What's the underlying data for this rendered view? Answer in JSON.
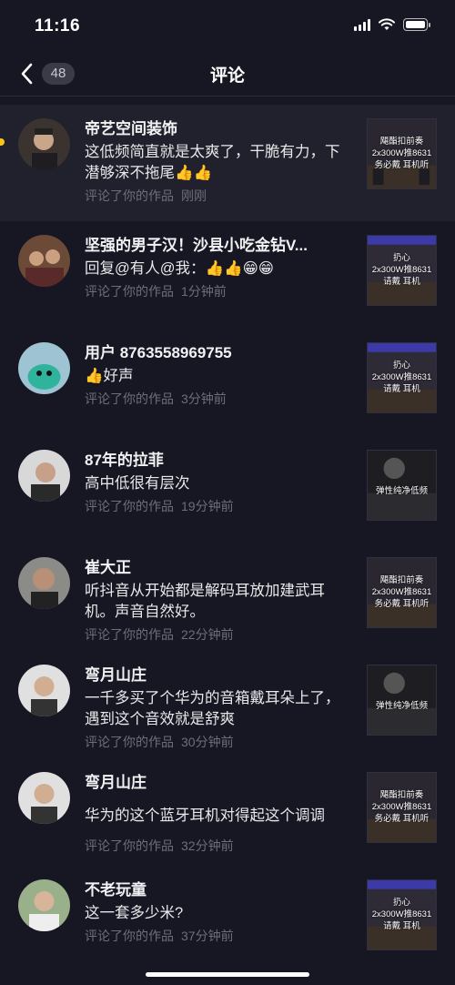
{
  "status_bar": {
    "time": "11:16"
  },
  "nav": {
    "back_count": "48",
    "title": "评论"
  },
  "comments": [
    {
      "name": "帝艺空间装饰",
      "text": "这低频简直就是太爽了，干脆有力，下潜够深不拖尾",
      "emoji": "👍👍",
      "action": "评论了你的作品",
      "time": "刚刚",
      "thumb_text": [
        "飓酯扣前奏",
        "2x300W推8631",
        "务必戴  耳机听"
      ]
    },
    {
      "name": "坚强的男子汉！沙县小吃金钻V...",
      "text": "回复@有人@我：",
      "emoji": "👍👍😁😁",
      "action": "评论了你的作品",
      "time": "1分钟前",
      "thumb_text": [
        "扔心",
        "2x300W推8631",
        "请戴  耳机"
      ]
    },
    {
      "name": "用户 8763558969755",
      "text": "好声",
      "emoji": "👍",
      "action": "评论了你的作品",
      "time": "3分钟前",
      "thumb_text": [
        "扔心",
        "2x300W推8631",
        "请戴  耳机"
      ]
    },
    {
      "name": "87年的拉菲",
      "text": "高中低很有层次",
      "emoji": "",
      "action": "评论了你的作品",
      "time": "19分钟前",
      "thumb_text": [
        "弹性纯净低频"
      ]
    },
    {
      "name": "崔大正",
      "text": "听抖音从开始都是解码耳放加建武耳机。声音自然好。",
      "emoji": "",
      "action": "评论了你的作品",
      "time": "22分钟前",
      "thumb_text": [
        "飓酯扣前奏",
        "2x300W推8631",
        "务必戴  耳机听"
      ]
    },
    {
      "name": "弯月山庄",
      "text": "一千多买了个华为的音箱戴耳朵上了，遇到这个音效就是舒爽",
      "emoji": "",
      "action": "评论了你的作品",
      "time": "30分钟前",
      "thumb_text": [
        "弹性纯净低频"
      ]
    },
    {
      "name": "弯月山庄",
      "text": "华为的这个蓝牙耳机对得起这个调调",
      "emoji": "",
      "action": "评论了你的作品",
      "time": "32分钟前",
      "thumb_text": [
        "飓酯扣前奏",
        "2x300W推8631",
        "务必戴  耳机听"
      ]
    },
    {
      "name": "不老玩童",
      "text": "这一套多少米?",
      "emoji": "",
      "action": "评论了你的作品",
      "time": "37分钟前",
      "thumb_text": [
        "扔心",
        "2x300W推8631",
        "请戴  耳机"
      ]
    }
  ]
}
